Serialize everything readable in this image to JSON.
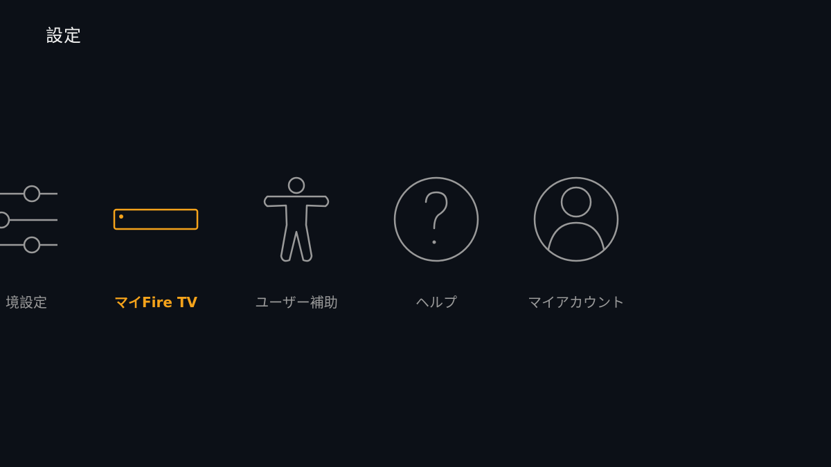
{
  "header": {
    "title": "設定"
  },
  "tiles": [
    {
      "label": "境設定",
      "icon": "sliders-icon",
      "selected": false
    },
    {
      "label": "マイFire TV",
      "icon": "fire-tv-device-icon",
      "selected": true
    },
    {
      "label": "ユーザー補助",
      "icon": "accessibility-icon",
      "selected": false
    },
    {
      "label": "ヘルプ",
      "icon": "help-icon",
      "selected": false
    },
    {
      "label": "マイアカウント",
      "icon": "account-icon",
      "selected": false
    }
  ],
  "colors": {
    "background": "#0c1017",
    "title": "#f2f2f2",
    "icon_default": "#9a9a9a",
    "accent_selected": "#f5a31b"
  }
}
